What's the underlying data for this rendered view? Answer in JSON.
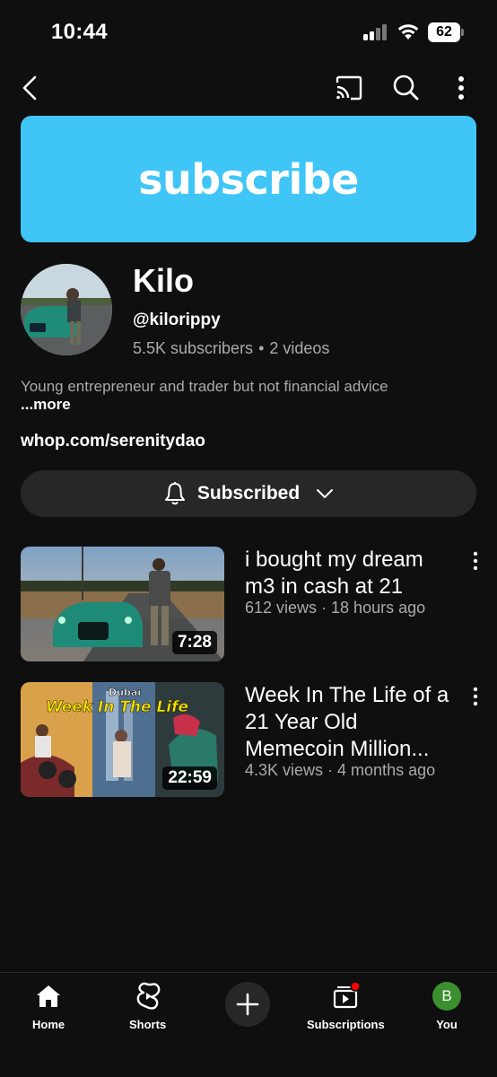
{
  "status_bar": {
    "time": "10:44",
    "battery": "62",
    "icons": [
      "signal-icon",
      "wifi-icon",
      "battery-icon"
    ]
  },
  "top_nav": {
    "icons": [
      "back-arrow-icon",
      "cast-icon",
      "search-icon",
      "more-vertical-icon"
    ]
  },
  "banner": {
    "text": "subscribe",
    "color": "#40c5f7"
  },
  "channel": {
    "name": "Kilo",
    "handle": "@kilorippy",
    "subscribers": "5.5K subscribers",
    "separator": "•",
    "videos": "2 videos",
    "description": "Young entrepreneur and trader but not financial advice",
    "more_label": "...more",
    "link": "whop.com/serenitydao"
  },
  "subscribe_button": {
    "label": "Subscribed",
    "icons": [
      "bell-icon",
      "chevron-down-icon"
    ]
  },
  "videos": [
    {
      "title": "i bought my dream m3 in cash at 21",
      "meta": "612 views · 18 hours ago",
      "duration": "7:28"
    },
    {
      "title": "Week In The Life of a 21 Year Old Memecoin Million...",
      "meta": "4.3K views · 4 months ago",
      "duration": "22:59",
      "thumbnail_text": {
        "tag": "Dubai",
        "headline": "Week In The Life"
      }
    }
  ],
  "bottom_nav": {
    "tabs": [
      {
        "label": "Home",
        "icon": "home-icon"
      },
      {
        "label": "Shorts",
        "icon": "shorts-icon"
      },
      {
        "label": "",
        "icon": "create-plus-icon"
      },
      {
        "label": "Subscriptions",
        "icon": "subscriptions-icon"
      },
      {
        "label": "You",
        "icon": "you-avatar",
        "avatar_letter": "B"
      }
    ]
  },
  "colors": {
    "background": "#0f0f0f",
    "surface": "#272727",
    "secondary_text": "#aaaaaa",
    "notification_dot": "#ff0000",
    "you_avatar": "#3b8f2e"
  }
}
